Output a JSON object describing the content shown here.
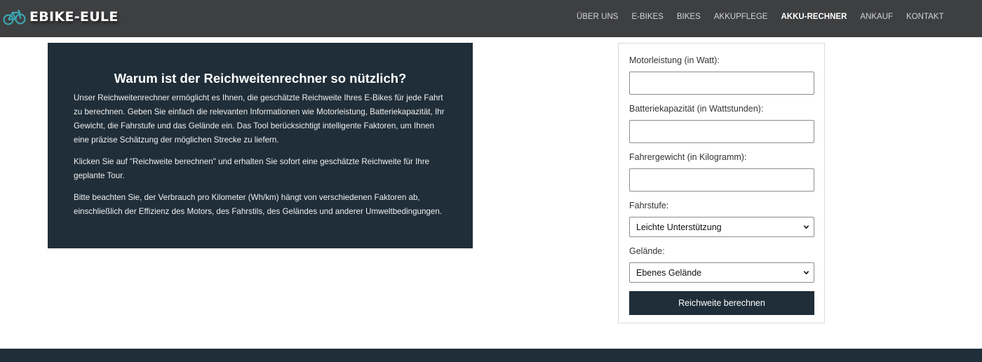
{
  "site": {
    "logo_text": "EBIKE-EULE",
    "logo_icon": "bicycle-icon"
  },
  "nav": {
    "items": [
      {
        "label": "ÜBER UNS"
      },
      {
        "label": "E-BIKES"
      },
      {
        "label": "BIKES"
      },
      {
        "label": "AKKUPFLEGE"
      },
      {
        "label": "AKKU-RECHNER",
        "active": true
      },
      {
        "label": "ANKAUF"
      },
      {
        "label": "KONTAKT"
      }
    ]
  },
  "info": {
    "title": "Warum ist der Reichweitenrechner so nützlich?",
    "paragraphs": [
      "Unser Reichweitenrechner ermöglicht es Ihnen, die geschätzte Reichweite Ihres E-Bikes für jede Fahrt zu berechnen. Geben Sie einfach die relevanten Informationen wie Motorleistung, Batteriekapazität, Ihr Gewicht, die Fahrstufe und das Gelände ein. Das Tool berücksichtigt intelligente Faktoren, um Ihnen eine präzise Schätzung der möglichen Strecke zu liefern.",
      "Klicken Sie auf \"Reichweite berechnen\" und erhalten Sie sofort eine geschätzte Reichweite für Ihre geplante Tour.",
      "Bitte beachten Sie, der Verbrauch pro Kilometer (Wh/km) hängt von verschiedenen Faktoren ab, einschließlich der Effizienz des Motors, des Fahrstils, des Geländes und anderer Umweltbedingungen."
    ]
  },
  "form": {
    "motor_label": "Motorleistung (in Watt):",
    "motor_value": "",
    "battery_label": "Batteriekapazität (in Wattstunden):",
    "battery_value": "",
    "weight_label": "Fahrergewicht (in Kilogramm):",
    "weight_value": "",
    "level_label": "Fahrstufe:",
    "level_selected": "Leichte Unterstützung",
    "terrain_label": "Gelände:",
    "terrain_selected": "Ebenes Gelände",
    "submit_label": "Reichweite berechnen"
  },
  "colors": {
    "header_bg": "#3e3f41",
    "accent_dark": "#1f2e39"
  }
}
